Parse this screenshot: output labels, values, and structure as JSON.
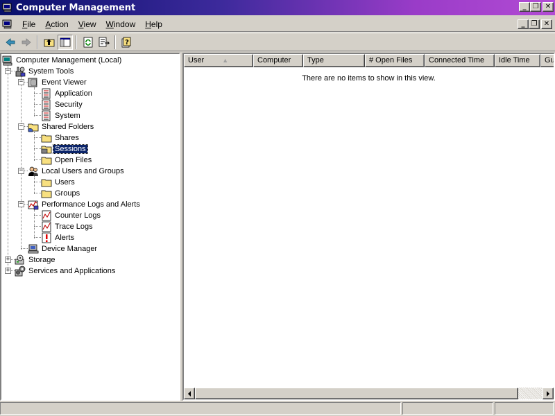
{
  "window": {
    "title": "Computer Management"
  },
  "caption_buttons": {
    "minimize": "_",
    "restore": "❐",
    "close": "✕"
  },
  "menu": {
    "items": [
      {
        "prefix": "",
        "underline": "F",
        "rest": "ile"
      },
      {
        "prefix": "",
        "underline": "A",
        "rest": "ction"
      },
      {
        "prefix": "",
        "underline": "V",
        "rest": "iew"
      },
      {
        "prefix": "",
        "underline": "W",
        "rest": "indow"
      },
      {
        "prefix": "",
        "underline": "H",
        "rest": "elp"
      }
    ]
  },
  "toolbar": {
    "buttons": [
      "back-arrow-icon",
      "forward-arrow-icon",
      "up-folder-icon",
      "show-hide-tree-icon",
      "refresh-icon",
      "export-list-icon",
      "help-icon"
    ]
  },
  "tree": {
    "root": "Computer Management (Local)",
    "system_tools": "System Tools",
    "event_viewer": "Event Viewer",
    "application": "Application",
    "security": "Security",
    "system": "System",
    "shared_folders": "Shared Folders",
    "shares": "Shares",
    "sessions": "Sessions",
    "open_files": "Open Files",
    "local_users": "Local Users and Groups",
    "users": "Users",
    "groups": "Groups",
    "perf_logs": "Performance Logs and Alerts",
    "counter_logs": "Counter Logs",
    "trace_logs": "Trace Logs",
    "alerts": "Alerts",
    "device_manager": "Device Manager",
    "storage": "Storage",
    "services": "Services and Applications",
    "expanded": "−",
    "collapsed": "+",
    "selected": "Sessions"
  },
  "list": {
    "columns": {
      "user": "User",
      "computer": "Computer",
      "type": "Type",
      "open_files": "# Open Files",
      "connected_time": "Connected Time",
      "idle_time": "Idle Time",
      "guest": "Gu"
    },
    "sort_indicator": "▲",
    "empty_message": "There are no items to show in this view."
  },
  "colors": {
    "title_gradient_start": "#08106b",
    "title_gradient_end": "#b24bd4",
    "selection": "#0a246a"
  }
}
